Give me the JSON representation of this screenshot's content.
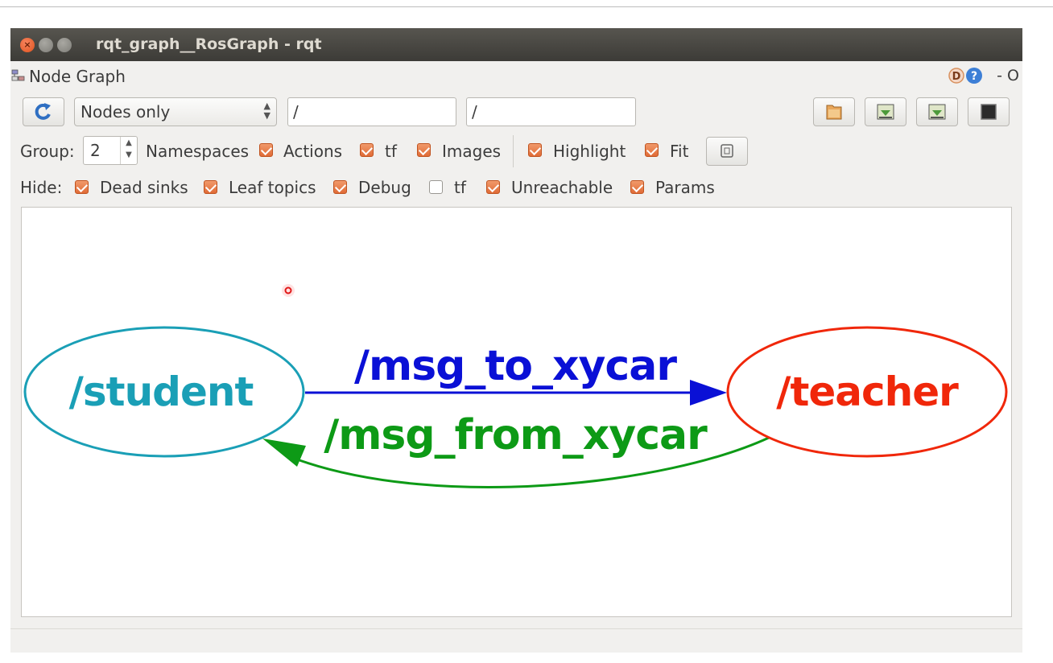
{
  "window": {
    "title": "rqt_graph__RosGraph - rqt",
    "close_glyph": "×"
  },
  "plugin": {
    "title": "Node Graph",
    "close_label": "- O"
  },
  "toolbar": {
    "mode_selected": "Nodes only",
    "filter_in": "/",
    "filter_out": "/"
  },
  "group_row": {
    "group_label": "Group:",
    "group_value": "2",
    "namespaces_label": "Namespaces",
    "actions_label": "Actions",
    "tf_label": "tf",
    "images_label": "Images",
    "highlight_label": "Highlight",
    "fit_label": "Fit",
    "actions_checked": true,
    "tf_checked": true,
    "images_checked": true,
    "highlight_checked": true,
    "fit_checked": true
  },
  "hide_row": {
    "hide_label": "Hide:",
    "dead_sinks_label": "Dead sinks",
    "leaf_topics_label": "Leaf topics",
    "debug_label": "Debug",
    "tf_label": "tf",
    "unreachable_label": "Unreachable",
    "params_label": "Params",
    "dead_sinks_checked": true,
    "leaf_topics_checked": true,
    "debug_checked": true,
    "tf_checked": false,
    "unreachable_checked": true,
    "params_checked": true
  },
  "graph": {
    "nodes": [
      {
        "name": "/student",
        "color": "#1a9fb6"
      },
      {
        "name": "/teacher",
        "color": "#f0270a"
      }
    ],
    "edges": [
      {
        "label": "/msg_to_xycar",
        "from": "/student",
        "to": "/teacher",
        "color": "#0a10d6"
      },
      {
        "label": "/msg_from_xycar",
        "from": "/teacher",
        "to": "/student",
        "color": "#0d9a16"
      }
    ]
  },
  "colors": {
    "checkbox_accent": "#e8773f",
    "titlebar": "#3c3b37",
    "close_button": "#e95420"
  }
}
